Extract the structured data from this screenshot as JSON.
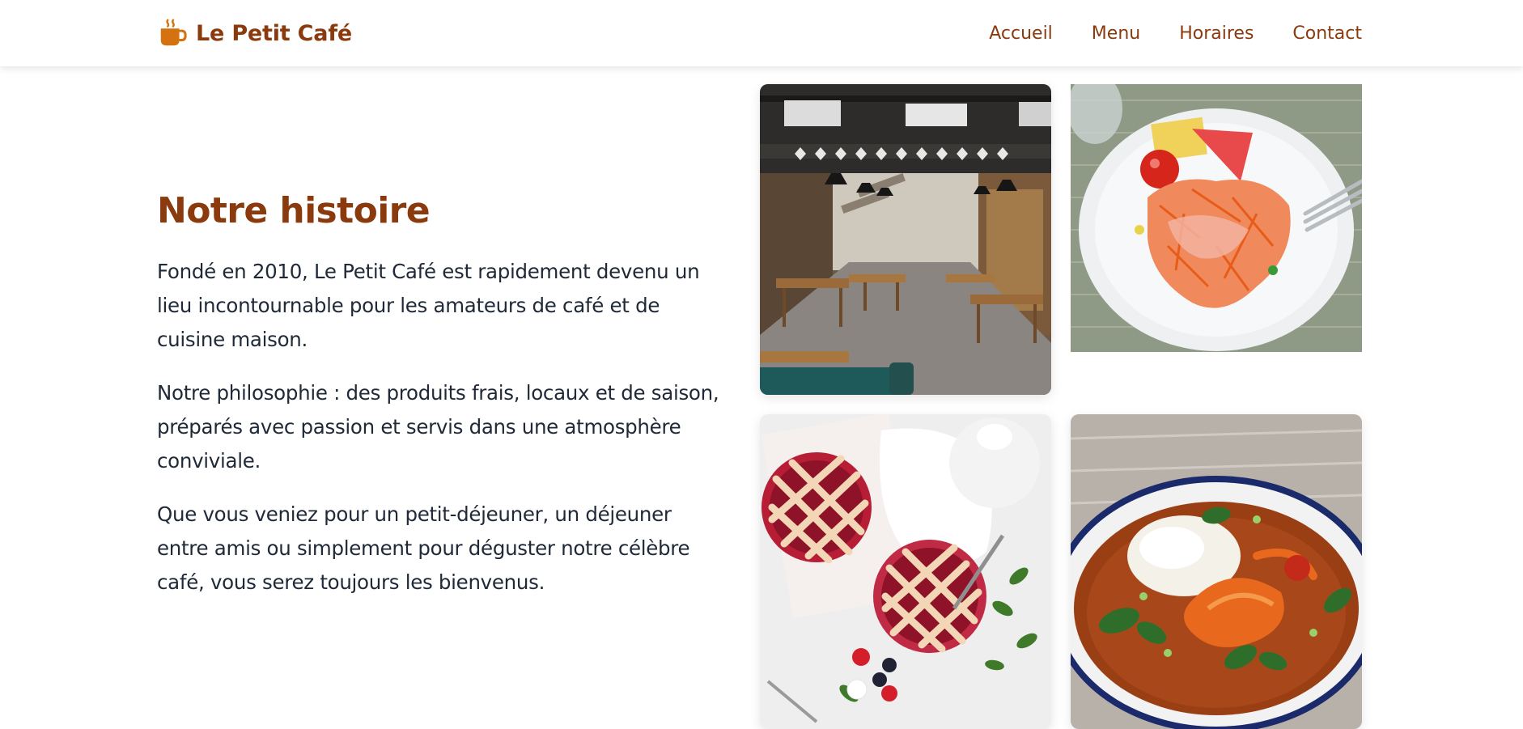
{
  "header": {
    "brand_name": "Le Petit Café",
    "brand_icon": "coffee-cup-icon",
    "nav": [
      {
        "label": "Accueil"
      },
      {
        "label": "Menu"
      },
      {
        "label": "Horaires"
      },
      {
        "label": "Contact"
      }
    ]
  },
  "story": {
    "title": "Notre histoire",
    "paragraphs": [
      "Fondé en 2010, Le Petit Café est rapidement devenu un lieu incontournable pour les amateurs de café et de cuisine maison.",
      "Notre philosophie : des produits frais, locaux et de saison, préparés avec passion et servis dans une atmosphère conviviale.",
      "Que vous veniez pour un petit-déjeuner, un déjeuner entre amis ou simplement pour déguster notre célèbre café, vous serez toujours les bienvenus."
    ]
  },
  "gallery": {
    "photos": [
      {
        "subject": "cafe interior"
      },
      {
        "subject": "salad plate"
      },
      {
        "subject": "berry pies"
      },
      {
        "subject": "shrimp curry bowl"
      }
    ]
  },
  "colors": {
    "brand": "#8b3a0e",
    "icon_orange": "#d4720f",
    "text": "#1f2937",
    "background": "#ffffff"
  }
}
